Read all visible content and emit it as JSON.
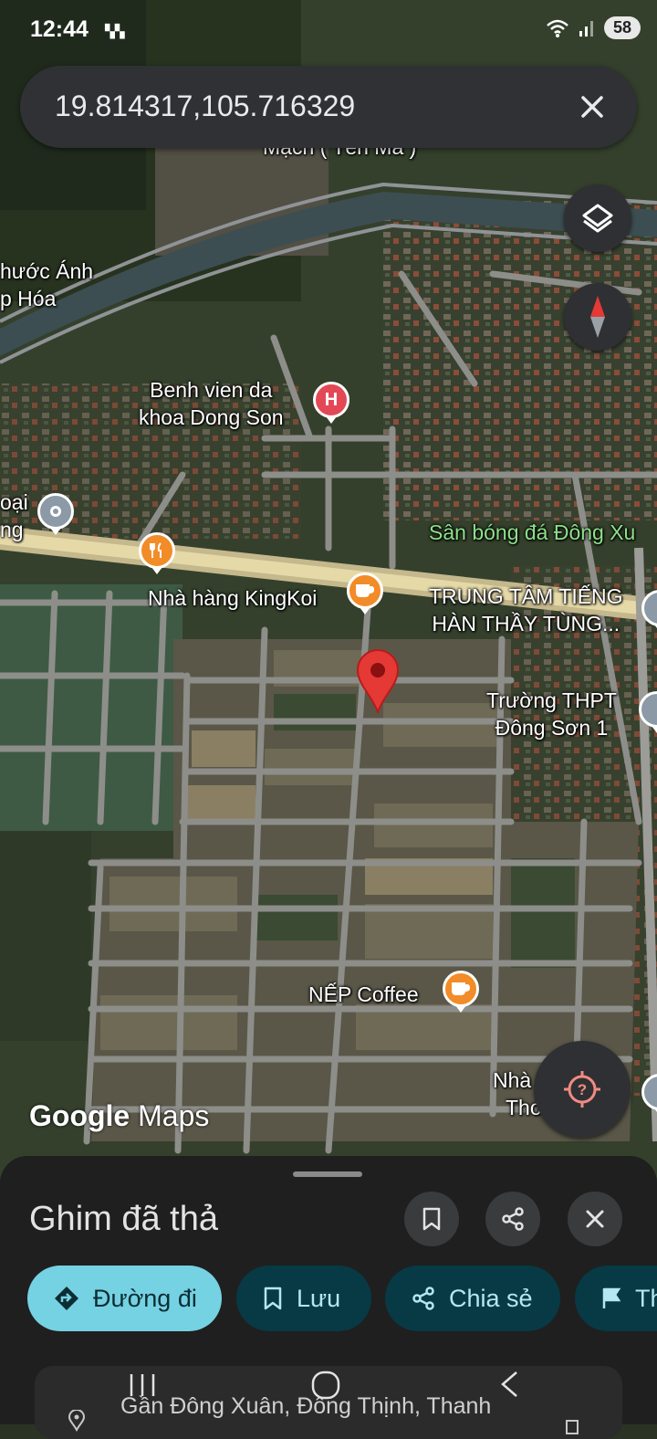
{
  "status_bar": {
    "time": "12:44",
    "battery": "58"
  },
  "search": {
    "query": "19.814317,105.716329"
  },
  "map": {
    "labels": {
      "partial_top": "Mạch ( Tên Mà )",
      "store_line1": "hước Ánh",
      "store_line2": "p Hóa",
      "hospital_line1": "Benh vien da",
      "hospital_line2": "khoa Dong Son",
      "left_edge_line1": "oại",
      "left_edge_line2": "ng",
      "stadium": "Sân bóng đá Đông Xu",
      "restaurant": "Nhà hàng KingKoi",
      "center_line1": "TRUNG TÂM TIẾNG",
      "center_line2": "HÀN THẦY TÙNG...",
      "school_line1": "Trường THPT",
      "school_line2": "Đông Sơn 1",
      "cafe": "NẾP Coffee",
      "bottom_line1": "Nhà",
      "bottom_line2": "Tho"
    },
    "logo": {
      "google": "Google",
      "maps": "Maps"
    }
  },
  "sheet": {
    "title": "Ghim đã thả",
    "chips": {
      "directions": "Đường đi",
      "save": "Lưu",
      "share": "Chia sẻ",
      "more": "Th"
    },
    "address": "Gần Đông Xuân, Đông Thịnh, Thanh"
  },
  "colors": {
    "accent": "#75d2e2",
    "pin": "#e53935",
    "sheet_bg": "#1f1f1f"
  }
}
